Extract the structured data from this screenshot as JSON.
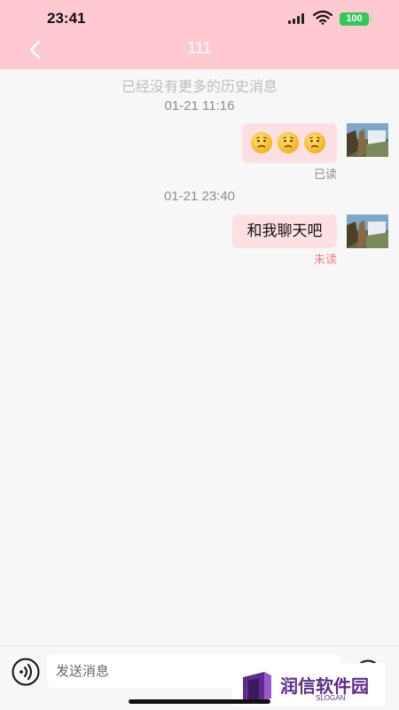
{
  "status_bar": {
    "time": "23:41",
    "battery": "100"
  },
  "nav": {
    "title": "111"
  },
  "chat": {
    "no_more_history": "已经没有更多的历史消息",
    "messages": [
      {
        "timestamp": "01-21 11:16",
        "content_type": "emoji",
        "emojis": [
          "confused-face-icon",
          "confused-face-icon",
          "confused-face-icon"
        ],
        "status": "已读"
      },
      {
        "timestamp": "01-21 23:40",
        "content_type": "text",
        "text": "和我聊天吧",
        "status": "未读"
      }
    ]
  },
  "input": {
    "placeholder": "发送消息"
  },
  "watermark": {
    "name": "润信软件园",
    "slogan": "SLOGAN"
  },
  "colors": {
    "header": "#ffc9d1",
    "bubble": "#fde0e3",
    "read": "#8e8e8e",
    "unread": "#f08080",
    "battery": "#34c759",
    "watermark": "#5e2d8c"
  }
}
